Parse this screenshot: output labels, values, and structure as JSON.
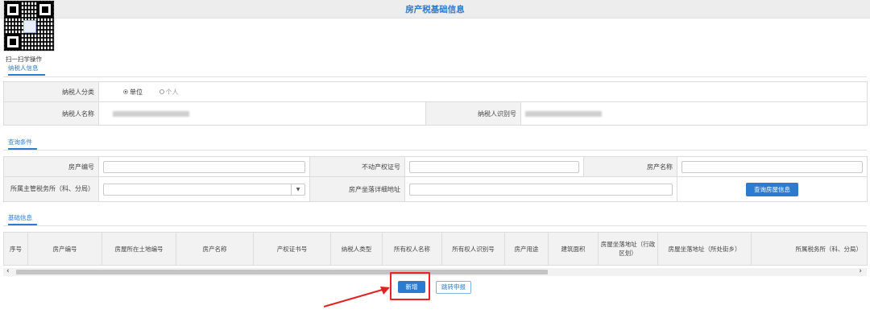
{
  "page": {
    "title": "房产税基础信息"
  },
  "qr": {
    "label": "扫一扫学操作"
  },
  "taxpayer_section": {
    "tab_label": "纳税人信息",
    "category_label": "纳税人分类",
    "options": [
      {
        "label": "单位",
        "checked": true
      },
      {
        "label": "个人",
        "checked": false
      }
    ],
    "name_label": "纳税人名称",
    "id_label": "纳税人识别号"
  },
  "query_section": {
    "tab_label": "查询条件",
    "property_no_label": "房产编号",
    "cert_no_label": "不动产权证号",
    "property_name_label": "房产名称",
    "tax_office_label": "所属主管税务所（科、分局）",
    "address_label": "房产坐落详细地址",
    "query_button": "查询房屋信息"
  },
  "basic_section": {
    "tab_label": "基础信息",
    "columns": [
      "序号",
      "房产编号",
      "房屋所在土地编号",
      "房产名称",
      "产权证书号",
      "纳税人类型",
      "所有权人名称",
      "所有权人识别号",
      "房产用途",
      "建筑面积",
      "房屋坐落地址（行政区划）",
      "房屋坐落地址（所处街乡）",
      "所属税务所（科、分局）"
    ]
  },
  "scrollbar": {
    "left_arrow": "‹",
    "right_arrow": "›"
  },
  "actions": {
    "add_button": "新增",
    "jump_button": "跳转申报"
  },
  "colors": {
    "accent": "#2b7bd0",
    "annotation": "#e22222"
  }
}
